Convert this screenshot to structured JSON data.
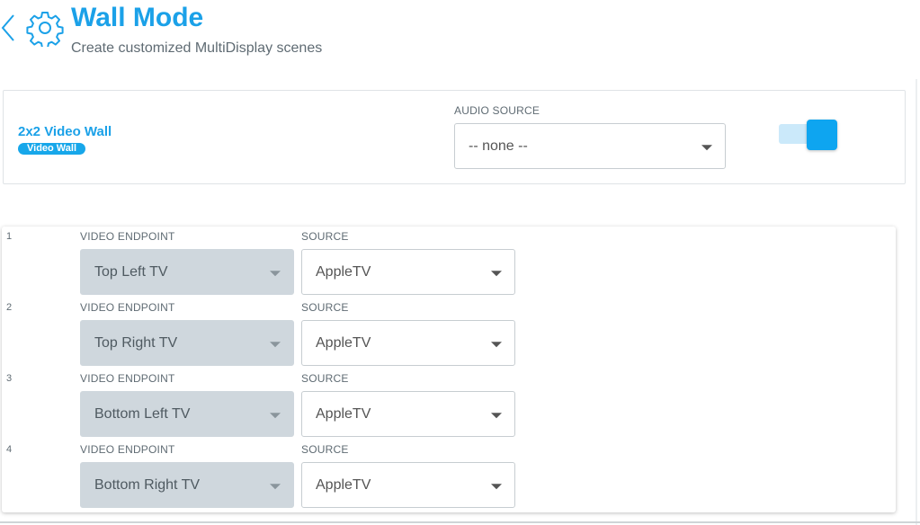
{
  "header": {
    "title": "Wall Mode",
    "subtitle": "Create customized MultiDisplay scenes",
    "back_icon": "chevron-left-icon",
    "settings_icon": "gear-icon"
  },
  "scene": {
    "name": "2x2 Video Wall",
    "badge": "Video Wall",
    "audio_source_label": "AUDIO SOURCE",
    "audio_source_value": "-- none --",
    "enabled": true
  },
  "endpoints": [
    {
      "index": "1",
      "endpoint_label": "VIDEO ENDPOINT",
      "endpoint_value": "Top Left TV",
      "source_label": "SOURCE",
      "source_value": "AppleTV"
    },
    {
      "index": "2",
      "endpoint_label": "VIDEO ENDPOINT",
      "endpoint_value": "Top Right TV",
      "source_label": "SOURCE",
      "source_value": "AppleTV"
    },
    {
      "index": "3",
      "endpoint_label": "VIDEO ENDPOINT",
      "endpoint_value": "Bottom Left TV",
      "source_label": "SOURCE",
      "source_value": "AppleTV"
    },
    {
      "index": "4",
      "endpoint_label": "VIDEO ENDPOINT",
      "endpoint_value": "Bottom Right TV",
      "source_label": "SOURCE",
      "source_value": "AppleTV"
    }
  ],
  "colors": {
    "accent": "#1ba1e8",
    "toggle_on": "#0ea5f0",
    "disabled_field": "#cfd7dd"
  }
}
